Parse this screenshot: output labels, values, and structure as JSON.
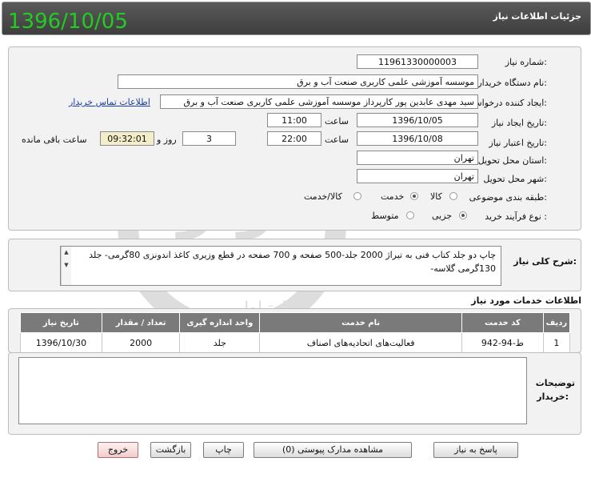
{
  "header": {
    "title": "جزئیات اطلاعات نیاز",
    "date_stamp": "1396/10/05"
  },
  "details": {
    "need_number_label": "شماره نیاز:",
    "need_number": "11961330000003",
    "buyer_label": "نام دستگاه خریدار:",
    "buyer": "موسسه آموزشی علمی کاربری صنعت آب و برق",
    "requester_label": "ایجاد کننده درخواست:",
    "requester": "سید مهدی عابدین پور کارپرداز موسسه آموزشی علمی کاربری صنعت آب و برق",
    "contact_link": "اطلاعات تماس خریدار",
    "created_label": "تاریخ ایجاد نیاز:",
    "created_date": "1396/10/05",
    "time_label": "ساعت",
    "created_time": "11:00",
    "valid_label": "تاریخ اعتبار نیاز:",
    "valid_date": "1396/10/08",
    "valid_time": "22:00",
    "days": "3",
    "days_label": "روز و",
    "remaining_time": "09:32:01",
    "remaining_label": "ساعت باقی مانده",
    "province_label": "استان محل تحویل:",
    "province": "تهران",
    "city_label": "شهر محل تحویل:",
    "city": "تهران",
    "category_label": "طبقه بندی موضوعی:",
    "category_options": [
      "کالا",
      "خدمت",
      "کالا/خدمت"
    ],
    "process_label": "نوع فرآیند خرید :",
    "process_options": [
      "جزیی",
      "متوسط"
    ]
  },
  "description": {
    "label": "شرح کلی نیاز:",
    "text": "چاپ  دو جلد کتاب فنی به تیراژ 2000 جلد-500 صفحه و 700 صفحه  در قطع وزیری  کاغذ اندونزی 80گرمی- جلد 130گرمی گلاسه-"
  },
  "services": {
    "title": "اطلاعات خدمات مورد نیاز",
    "columns": [
      "ردیف",
      "کد خدمت",
      "نام خدمت",
      "واحد اندازه گیری",
      "تعداد / مقدار",
      "تاریخ نیاز"
    ],
    "rows": [
      [
        "1",
        "ط-94-942",
        "فعالیت‌های اتحادیه‌های اصناف",
        "جلد",
        "2000",
        "1396/10/30"
      ]
    ]
  },
  "buyer_notes": {
    "label_line1": "توضیحات",
    "label_line2": "خریدار:",
    "text": ""
  },
  "buttons": {
    "reply": "پاسخ به نیاز",
    "attachments": "مشاهده مدارک پیوستی (0)",
    "print": "چاپ",
    "back": "بازگشت",
    "exit": "خروج"
  },
  "watermark": {
    "line1": "هزاره",
    "line2": "گستران",
    "line3": "ارتباط"
  }
}
